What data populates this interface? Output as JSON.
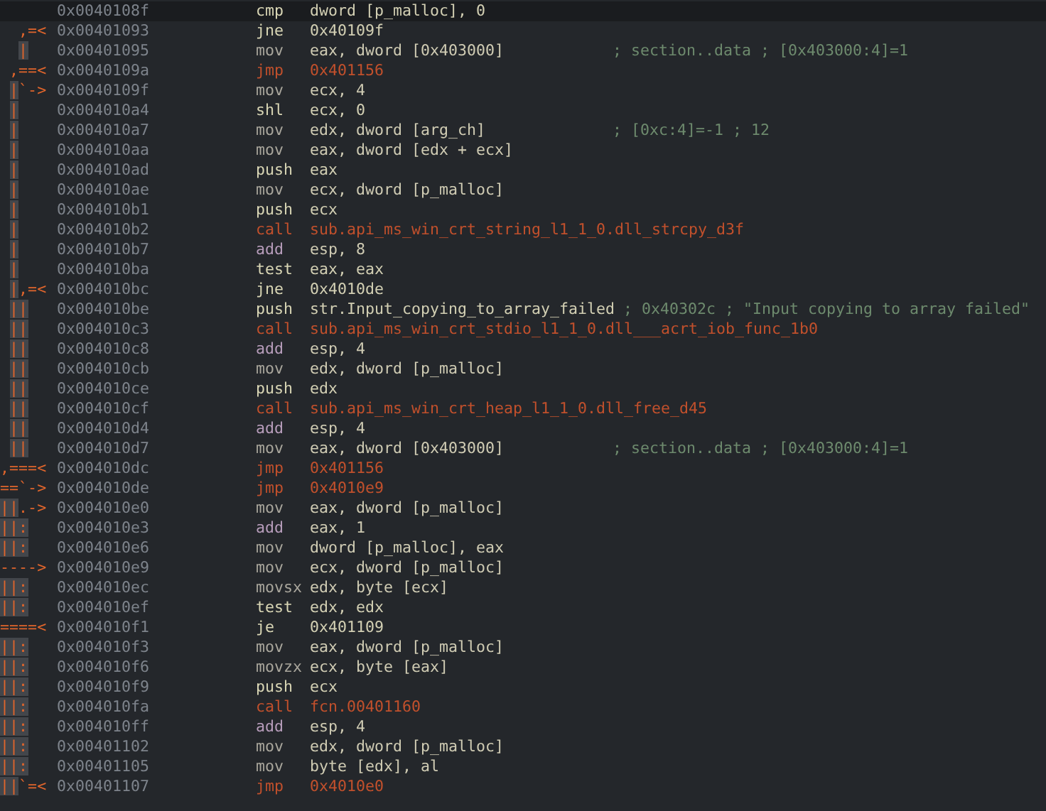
{
  "rows": [
    {
      "arrows": "",
      "address": "0x0040108f",
      "mnemonic": "cmp",
      "kind": "test",
      "operands": "dword [p_malloc], 0",
      "selected": true
    },
    {
      "arrows": "  ,=<",
      "address": "0x00401093",
      "mnemonic": "jne",
      "kind": "test",
      "operands": "0x40109f",
      "selected": false
    },
    {
      "arrows": "  |",
      "address": "0x00401095",
      "mnemonic": "mov",
      "kind": "move",
      "operands": "eax, dword [0x403000]",
      "comment": "; section..data ; [0x403000:4]=1",
      "selected": false
    },
    {
      "arrows": " ,==<",
      "address": "0x0040109a",
      "mnemonic": "jmp",
      "kind": "flow",
      "operands": "0x401156",
      "selected": false
    },
    {
      "arrows": " |`->",
      "address": "0x0040109f",
      "mnemonic": "mov",
      "kind": "move",
      "operands": "ecx, 4",
      "selected": false
    },
    {
      "arrows": " |",
      "address": "0x004010a4",
      "mnemonic": "shl",
      "kind": "test",
      "operands": "ecx, 0",
      "selected": false
    },
    {
      "arrows": " |",
      "address": "0x004010a7",
      "mnemonic": "mov",
      "kind": "move",
      "operands": "edx, dword [arg_ch]",
      "comment": "; [0xc:4]=-1 ; 12",
      "selected": false
    },
    {
      "arrows": " |",
      "address": "0x004010aa",
      "mnemonic": "mov",
      "kind": "move",
      "operands": "eax, dword [edx + ecx]",
      "selected": false
    },
    {
      "arrows": " |",
      "address": "0x004010ad",
      "mnemonic": "push",
      "kind": "test",
      "operands": "eax",
      "selected": false
    },
    {
      "arrows": " |",
      "address": "0x004010ae",
      "mnemonic": "mov",
      "kind": "move",
      "operands": "ecx, dword [p_malloc]",
      "selected": false
    },
    {
      "arrows": " |",
      "address": "0x004010b1",
      "mnemonic": "push",
      "kind": "test",
      "operands": "ecx",
      "selected": false
    },
    {
      "arrows": " |",
      "address": "0x004010b2",
      "mnemonic": "call",
      "kind": "flow",
      "operands": "sub.api_ms_win_crt_string_l1_1_0.dll_strcpy_d3f",
      "selected": false
    },
    {
      "arrows": " |",
      "address": "0x004010b7",
      "mnemonic": "add",
      "kind": "arith",
      "operands": "esp, 8",
      "selected": false
    },
    {
      "arrows": " |",
      "address": "0x004010ba",
      "mnemonic": "test",
      "kind": "test",
      "operands": "eax, eax",
      "selected": false
    },
    {
      "arrows": " |,=<",
      "address": "0x004010bc",
      "mnemonic": "jne",
      "kind": "test",
      "operands": "0x4010de",
      "selected": false
    },
    {
      "arrows": " ||",
      "address": "0x004010be",
      "mnemonic": "push",
      "kind": "test",
      "operands": "str.Input_copying_to_array_failed",
      "comment": "; 0x40302c ; \"Input copying to array failed\"",
      "selected": false
    },
    {
      "arrows": " ||",
      "address": "0x004010c3",
      "mnemonic": "call",
      "kind": "flow",
      "operands": "sub.api_ms_win_crt_stdio_l1_1_0.dll___acrt_iob_func_1b0",
      "selected": false
    },
    {
      "arrows": " ||",
      "address": "0x004010c8",
      "mnemonic": "add",
      "kind": "arith",
      "operands": "esp, 4",
      "selected": false
    },
    {
      "arrows": " ||",
      "address": "0x004010cb",
      "mnemonic": "mov",
      "kind": "move",
      "operands": "edx, dword [p_malloc]",
      "selected": false
    },
    {
      "arrows": " ||",
      "address": "0x004010ce",
      "mnemonic": "push",
      "kind": "test",
      "operands": "edx",
      "selected": false
    },
    {
      "arrows": " ||",
      "address": "0x004010cf",
      "mnemonic": "call",
      "kind": "flow",
      "operands": "sub.api_ms_win_crt_heap_l1_1_0.dll_free_d45",
      "selected": false
    },
    {
      "arrows": " ||",
      "address": "0x004010d4",
      "mnemonic": "add",
      "kind": "arith",
      "operands": "esp, 4",
      "selected": false
    },
    {
      "arrows": " ||",
      "address": "0x004010d7",
      "mnemonic": "mov",
      "kind": "move",
      "operands": "eax, dword [0x403000]",
      "comment": "; section..data ; [0x403000:4]=1",
      "selected": false
    },
    {
      "arrows": ",===<",
      "address": "0x004010dc",
      "mnemonic": "jmp",
      "kind": "flow",
      "operands": "0x401156",
      "selected": false
    },
    {
      "arrows": "==`->",
      "address": "0x004010de",
      "mnemonic": "jmp",
      "kind": "flow",
      "operands": "0x4010e9",
      "selected": false
    },
    {
      "arrows": "||.->",
      "address": "0x004010e0",
      "mnemonic": "mov",
      "kind": "move",
      "operands": "eax, dword [p_malloc]",
      "selected": false
    },
    {
      "arrows": "||:",
      "address": "0x004010e3",
      "mnemonic": "add",
      "kind": "arith",
      "operands": "eax, 1",
      "selected": false
    },
    {
      "arrows": "||:",
      "address": "0x004010e6",
      "mnemonic": "mov",
      "kind": "move",
      "operands": "dword [p_malloc], eax",
      "selected": false
    },
    {
      "arrows": "---->",
      "address": "0x004010e9",
      "mnemonic": "mov",
      "kind": "move",
      "operands": "ecx, dword [p_malloc]",
      "selected": false
    },
    {
      "arrows": "||:",
      "address": "0x004010ec",
      "mnemonic": "movsx",
      "kind": "move",
      "operands": "edx, byte [ecx]",
      "selected": false
    },
    {
      "arrows": "||:",
      "address": "0x004010ef",
      "mnemonic": "test",
      "kind": "test",
      "operands": "edx, edx",
      "selected": false
    },
    {
      "arrows": "====<",
      "address": "0x004010f1",
      "mnemonic": "je",
      "kind": "test",
      "operands": "0x401109",
      "selected": false
    },
    {
      "arrows": "||:",
      "address": "0x004010f3",
      "mnemonic": "mov",
      "kind": "move",
      "operands": "eax, dword [p_malloc]",
      "selected": false
    },
    {
      "arrows": "||:",
      "address": "0x004010f6",
      "mnemonic": "movzx",
      "kind": "move",
      "operands": "ecx, byte [eax]",
      "selected": false
    },
    {
      "arrows": "||:",
      "address": "0x004010f9",
      "mnemonic": "push",
      "kind": "test",
      "operands": "ecx",
      "selected": false
    },
    {
      "arrows": "||:",
      "address": "0x004010fa",
      "mnemonic": "call",
      "kind": "flow",
      "operands": "fcn.00401160",
      "selected": false
    },
    {
      "arrows": "||:",
      "address": "0x004010ff",
      "mnemonic": "add",
      "kind": "arith",
      "operands": "esp, 4",
      "selected": false
    },
    {
      "arrows": "||:",
      "address": "0x00401102",
      "mnemonic": "mov",
      "kind": "move",
      "operands": "edx, dword [p_malloc]",
      "selected": false
    },
    {
      "arrows": "||:",
      "address": "0x00401105",
      "mnemonic": "mov",
      "kind": "move",
      "operands": "byte [edx], al",
      "selected": false
    },
    {
      "arrows": "||`=<",
      "address": "0x00401107",
      "mnemonic": "jmp",
      "kind": "flow",
      "operands": "0x4010e0",
      "selected": false
    }
  ]
}
